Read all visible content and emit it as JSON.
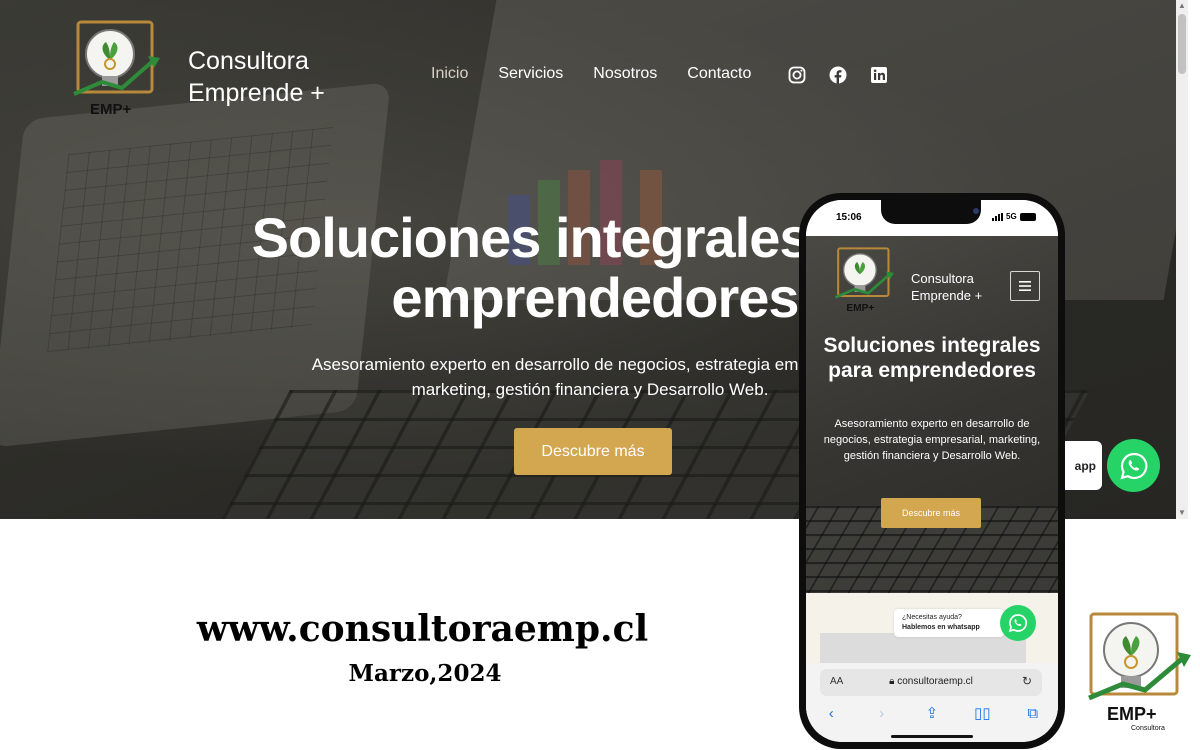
{
  "header": {
    "brand_line1": "Consultora",
    "brand_line2": "Emprende +",
    "logo_text": "EMP+",
    "logo_sub": "Consultora"
  },
  "nav": {
    "items": [
      {
        "label": "Inicio",
        "active": true
      },
      {
        "label": "Servicios"
      },
      {
        "label": "Nosotros"
      },
      {
        "label": "Contacto"
      }
    ],
    "social_icons": [
      "instagram-icon",
      "facebook-icon",
      "linkedin-icon"
    ]
  },
  "hero": {
    "title_line1": "Soluciones integrales para",
    "title_line2": "emprendedores",
    "subtitle": "Asesoramiento experto en desarrollo de negocios, estrategia empresarial, marketing, gestión financiera y Desarrollo Web.",
    "cta_label": "Descubre más"
  },
  "whatsapp": {
    "tooltip_partial": "app"
  },
  "footer": {
    "url": "www.consultoraemp.cl",
    "date": "Marzo,2024"
  },
  "phone": {
    "time": "15:06",
    "network": "5G",
    "brand_line1": "Consultora",
    "brand_line2": "Emprende +",
    "title": "Soluciones integrales para emprendedores",
    "subtitle": "Asesoramiento experto en desarrollo de negocios, estrategia empresarial, marketing, gestión financiera y Desarrollo Web.",
    "cta_label": "Descubre más",
    "wa_tip_line1": "¿Necesitas ayuda?",
    "wa_tip_line2": "Hablemos en whatsapp",
    "address_aa": "AA",
    "address_url": "consultoraemp.cl",
    "toolbar_icons": [
      "back-icon",
      "forward-icon",
      "share-icon",
      "bookmarks-icon",
      "tabs-icon"
    ]
  },
  "colors": {
    "accent_gold": "#d3a650",
    "whatsapp_green": "#25d366",
    "hero_dark": "#2e2d2a"
  }
}
